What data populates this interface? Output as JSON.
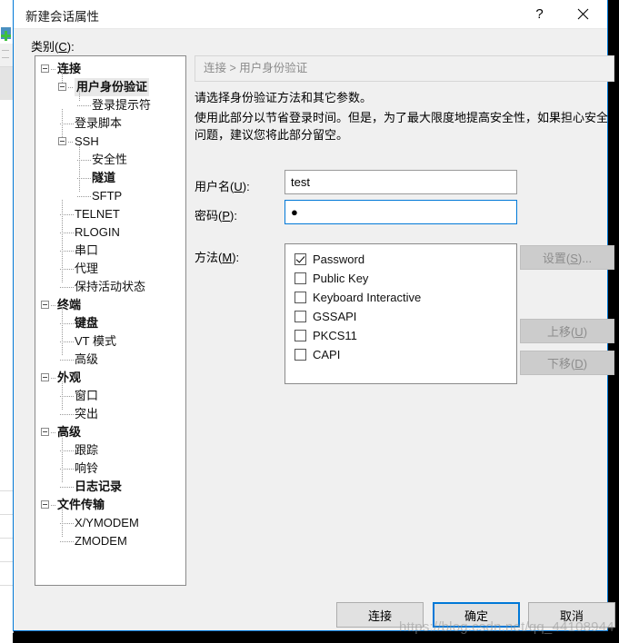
{
  "window": {
    "title": "新建会话属性",
    "help_icon": "question-mark-icon",
    "close_icon": "close-icon",
    "accent_color": "#0078d7"
  },
  "category": {
    "label_pre": "类别(",
    "label_key": "C",
    "label_post": "):"
  },
  "tree": {
    "items": [
      {
        "label": "连接",
        "depth": 0,
        "bold": true,
        "expander": true,
        "selected": false
      },
      {
        "label": "用户身份验证",
        "depth": 1,
        "bold": true,
        "expander": true,
        "selected": true
      },
      {
        "label": "登录提示符",
        "depth": 2,
        "bold": false,
        "expander": false,
        "selected": false
      },
      {
        "label": "登录脚本",
        "depth": 1,
        "bold": false,
        "expander": false,
        "selected": false
      },
      {
        "label": "SSH",
        "depth": 1,
        "bold": false,
        "expander": true,
        "selected": false
      },
      {
        "label": "安全性",
        "depth": 2,
        "bold": false,
        "expander": false,
        "selected": false
      },
      {
        "label": "隧道",
        "depth": 2,
        "bold": true,
        "expander": false,
        "selected": false
      },
      {
        "label": "SFTP",
        "depth": 2,
        "bold": false,
        "expander": false,
        "selected": false
      },
      {
        "label": "TELNET",
        "depth": 1,
        "bold": false,
        "expander": false,
        "selected": false
      },
      {
        "label": "RLOGIN",
        "depth": 1,
        "bold": false,
        "expander": false,
        "selected": false
      },
      {
        "label": "串口",
        "depth": 1,
        "bold": false,
        "expander": false,
        "selected": false
      },
      {
        "label": "代理",
        "depth": 1,
        "bold": false,
        "expander": false,
        "selected": false
      },
      {
        "label": "保持活动状态",
        "depth": 1,
        "bold": false,
        "expander": false,
        "selected": false
      },
      {
        "label": "终端",
        "depth": 0,
        "bold": true,
        "expander": true,
        "selected": false
      },
      {
        "label": "键盘",
        "depth": 1,
        "bold": true,
        "expander": false,
        "selected": false
      },
      {
        "label": "VT 模式",
        "depth": 1,
        "bold": false,
        "expander": false,
        "selected": false
      },
      {
        "label": "高级",
        "depth": 1,
        "bold": false,
        "expander": false,
        "selected": false
      },
      {
        "label": "外观",
        "depth": 0,
        "bold": true,
        "expander": true,
        "selected": false
      },
      {
        "label": "窗口",
        "depth": 1,
        "bold": false,
        "expander": false,
        "selected": false
      },
      {
        "label": "突出",
        "depth": 1,
        "bold": false,
        "expander": false,
        "selected": false
      },
      {
        "label": "高级",
        "depth": 0,
        "bold": true,
        "expander": true,
        "selected": false
      },
      {
        "label": "跟踪",
        "depth": 1,
        "bold": false,
        "expander": false,
        "selected": false
      },
      {
        "label": "响铃",
        "depth": 1,
        "bold": false,
        "expander": false,
        "selected": false
      },
      {
        "label": "日志记录",
        "depth": 1,
        "bold": true,
        "expander": false,
        "selected": false
      },
      {
        "label": "文件传输",
        "depth": 0,
        "bold": true,
        "expander": true,
        "selected": false
      },
      {
        "label": "X/YMODEM",
        "depth": 1,
        "bold": false,
        "expander": false,
        "selected": false
      },
      {
        "label": "ZMODEM",
        "depth": 1,
        "bold": false,
        "expander": false,
        "selected": false
      }
    ]
  },
  "content": {
    "breadcrumb": "连接 > 用户身份验证",
    "description1": "请选择身份验证方法和其它参数。",
    "description2": "使用此部分以节省登录时间。但是，为了最大限度地提高安全性，如果担心安全问题，建议您将此部分留空。",
    "username": {
      "label_pre": "用户名(",
      "label_key": "U",
      "label_post": "):",
      "value": "test",
      "placeholder": ""
    },
    "password": {
      "label_pre": "密码(",
      "label_key": "P",
      "label_post": "):",
      "value": "●",
      "placeholder": ""
    },
    "method": {
      "label_pre": "方法(",
      "label_key": "M",
      "label_post": "):",
      "options": [
        {
          "label": "Password",
          "checked": true
        },
        {
          "label": "Public Key",
          "checked": false
        },
        {
          "label": "Keyboard Interactive",
          "checked": false
        },
        {
          "label": "GSSAPI",
          "checked": false
        },
        {
          "label": "PKCS11",
          "checked": false
        },
        {
          "label": "CAPI",
          "checked": false
        }
      ]
    },
    "side_buttons": [
      {
        "label_pre": "设置(",
        "label_key": "S",
        "label_post": ")...",
        "enabled": false
      },
      {
        "label_pre": "上移(",
        "label_key": "U",
        "label_post": ")",
        "enabled": false
      },
      {
        "label_pre": "下移(",
        "label_key": "D",
        "label_post": ")",
        "enabled": false
      }
    ]
  },
  "footer": {
    "connect": "连接",
    "ok": "确定",
    "cancel": "取消"
  },
  "watermark": "https://blog.csdn.net/qq_44108944"
}
